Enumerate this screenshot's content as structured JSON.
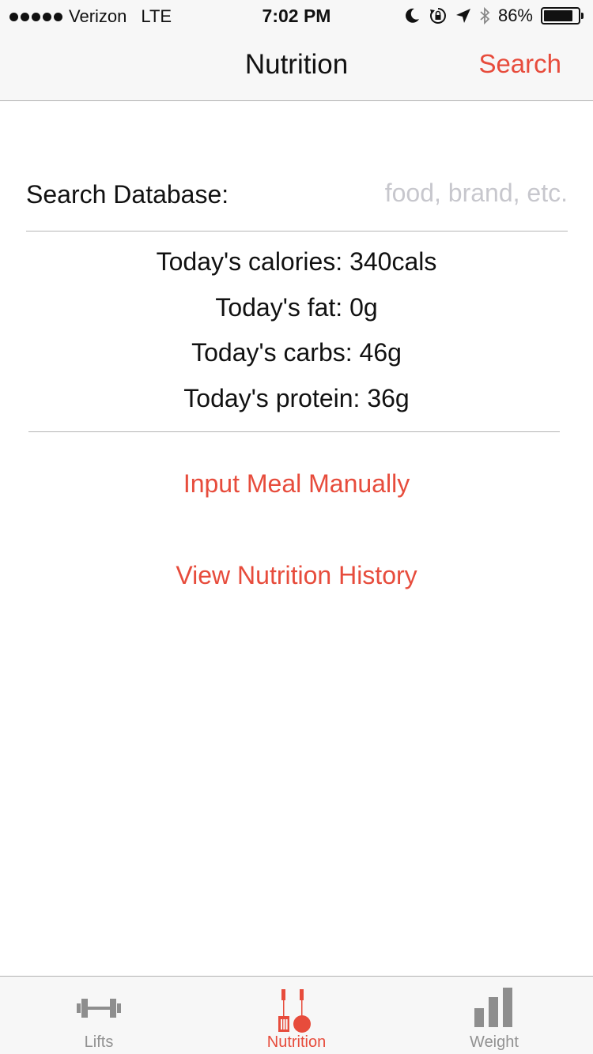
{
  "status_bar": {
    "carrier": "Verizon",
    "network": "LTE",
    "time": "7:02 PM",
    "battery": "86%",
    "battery_level": 0.86
  },
  "nav": {
    "title": "Nutrition",
    "search_button": "Search"
  },
  "search": {
    "label": "Search Database:",
    "placeholder": "food, brand, etc.",
    "value": ""
  },
  "stats": {
    "calories": "Today's calories: 340cals",
    "fat": "Today's fat: 0g",
    "carbs": "Today's carbs: 46g",
    "protein": "Today's protein: 36g"
  },
  "actions": {
    "input_meal": "Input Meal Manually",
    "view_history": "View Nutrition History"
  },
  "tabs": [
    {
      "label": "Lifts",
      "icon": "dumbbell-icon",
      "active": false
    },
    {
      "label": "Nutrition",
      "icon": "fork-knife-icon",
      "active": true
    },
    {
      "label": "Weight",
      "icon": "bar-chart-icon",
      "active": false
    }
  ],
  "colors": {
    "accent": "#e74c3c",
    "inactive_tab": "#929292",
    "bar_background": "#f7f7f7"
  }
}
